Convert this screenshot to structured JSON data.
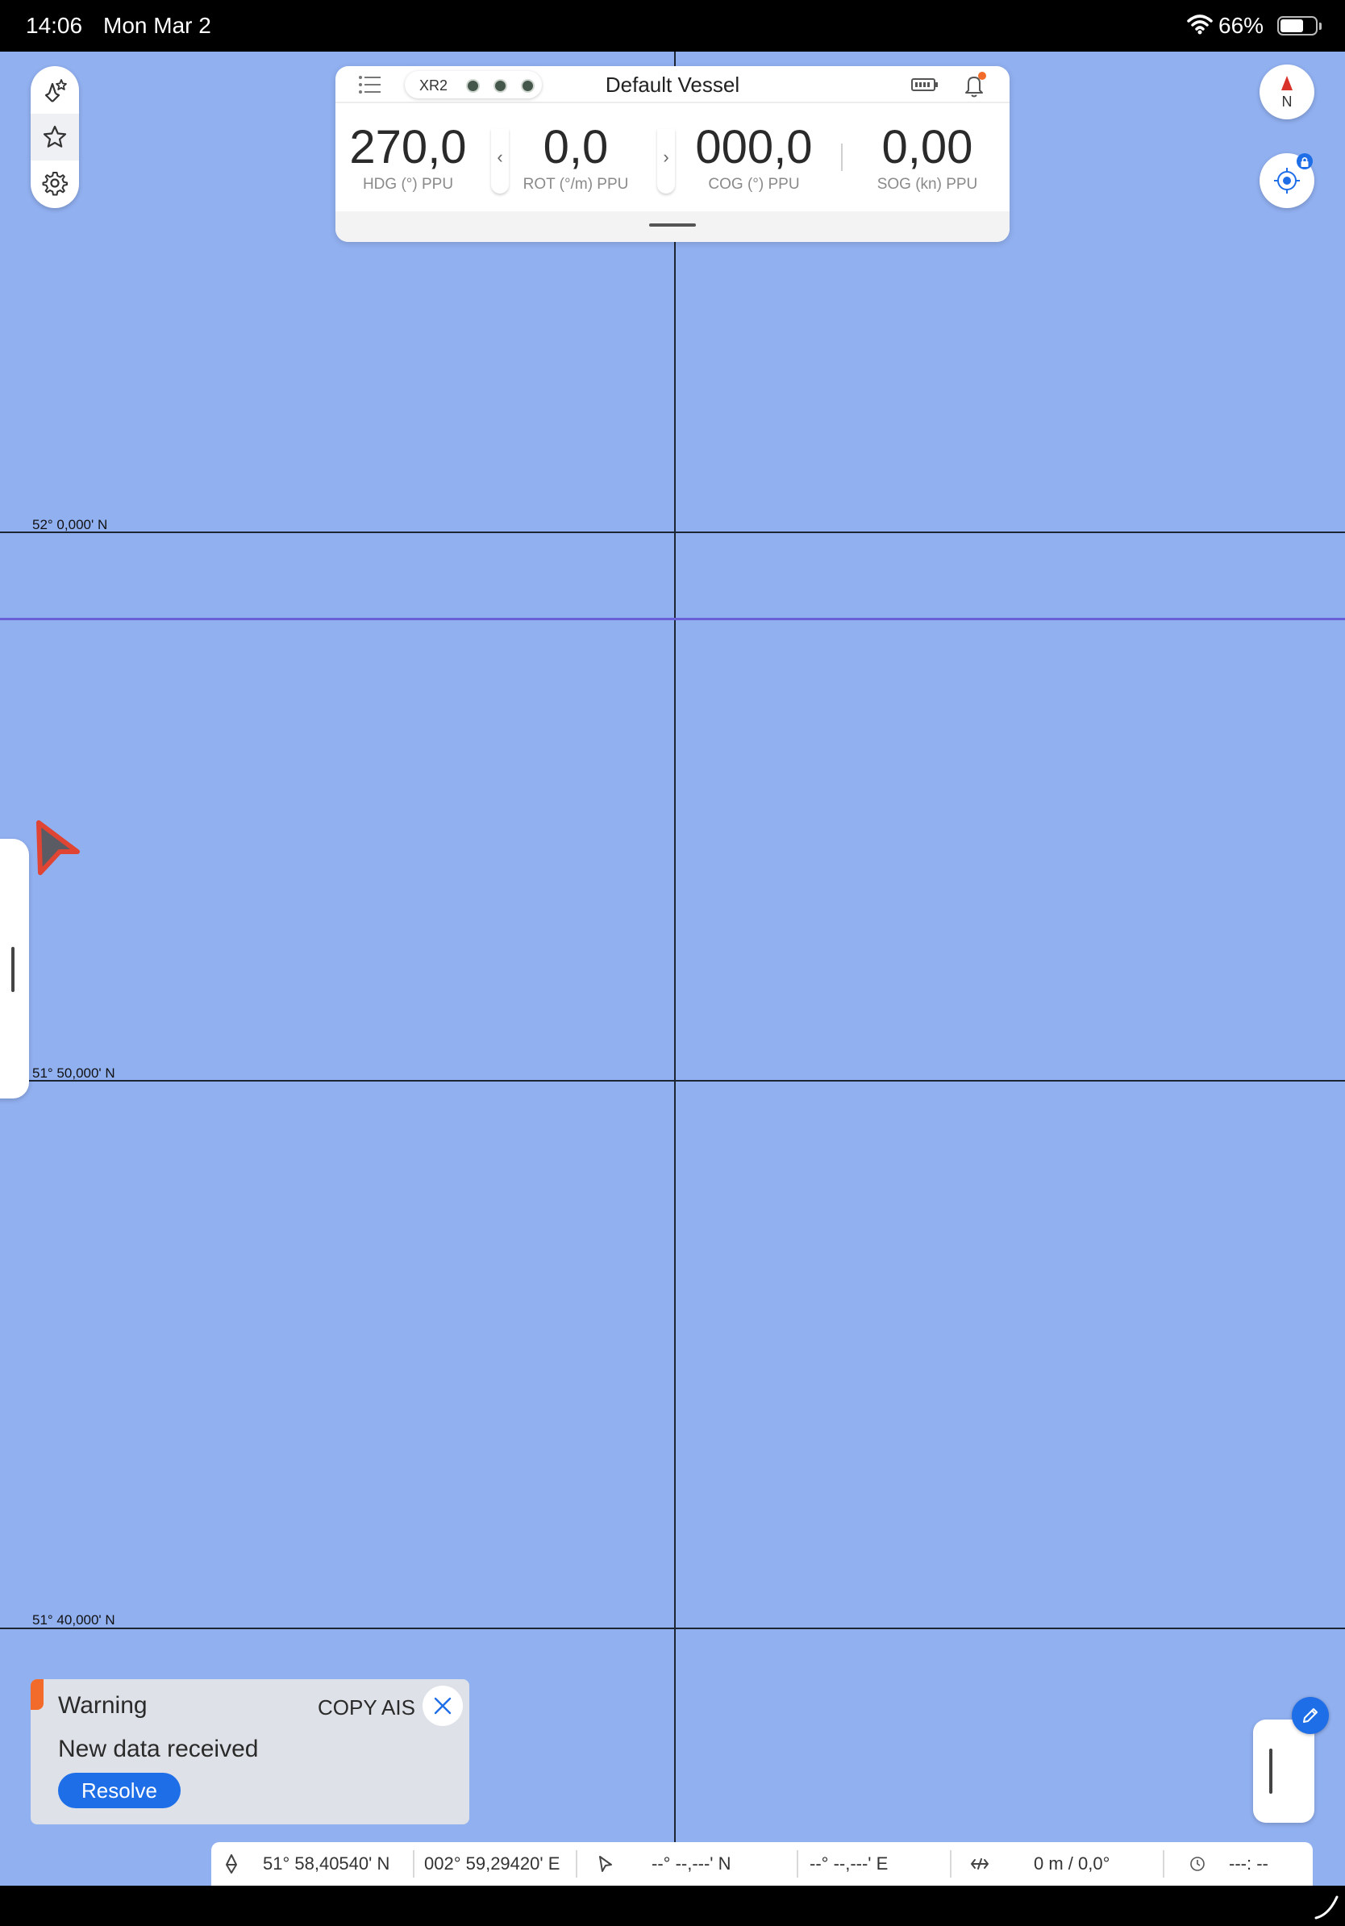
{
  "status_bar": {
    "time": "14:06",
    "date": "Mon Mar 2",
    "battery_percent": "66%",
    "battery_level": 0.66
  },
  "map": {
    "background_color": "#91b0f0",
    "latitude_labels": [
      "52° 0,000' N",
      "51° 50,000' N",
      "51° 40,000' N"
    ]
  },
  "left_palette": {
    "icons": [
      "vessel-star-icon",
      "star-icon",
      "gear-icon"
    ],
    "selected_index": 1
  },
  "vessel_card": {
    "connection_label": "XR2",
    "connection_dots": 3,
    "vessel_name": "Default Vessel",
    "metrics": [
      {
        "value": "270,0",
        "label": "HDG (°) PPU"
      },
      {
        "value": "0,0",
        "label": "ROT (°/m) PPU"
      },
      {
        "value": "000,0",
        "label": "COG (°) PPU"
      },
      {
        "value": "0,00",
        "label": "SOG (kn) PPU"
      }
    ],
    "prev_arrow": "‹",
    "next_arrow": "›"
  },
  "compass": {
    "label": "N",
    "accent_color": "#d8322b"
  },
  "warning_toast": {
    "title": "Warning",
    "source": "COPY AIS",
    "message": "New data received",
    "action_label": "Resolve",
    "accent_color": "#f26b2a",
    "button_color": "#1e6ee8"
  },
  "coordinate_bar": {
    "vessel_lat": "51° 58,40540' N",
    "vessel_lon": "002° 59,29420' E",
    "cursor_lat": "--° --,---' N",
    "cursor_lon": "--° --,---' E",
    "range_bearing": "0 m / 0,0°",
    "time_to_go": "---: --"
  }
}
